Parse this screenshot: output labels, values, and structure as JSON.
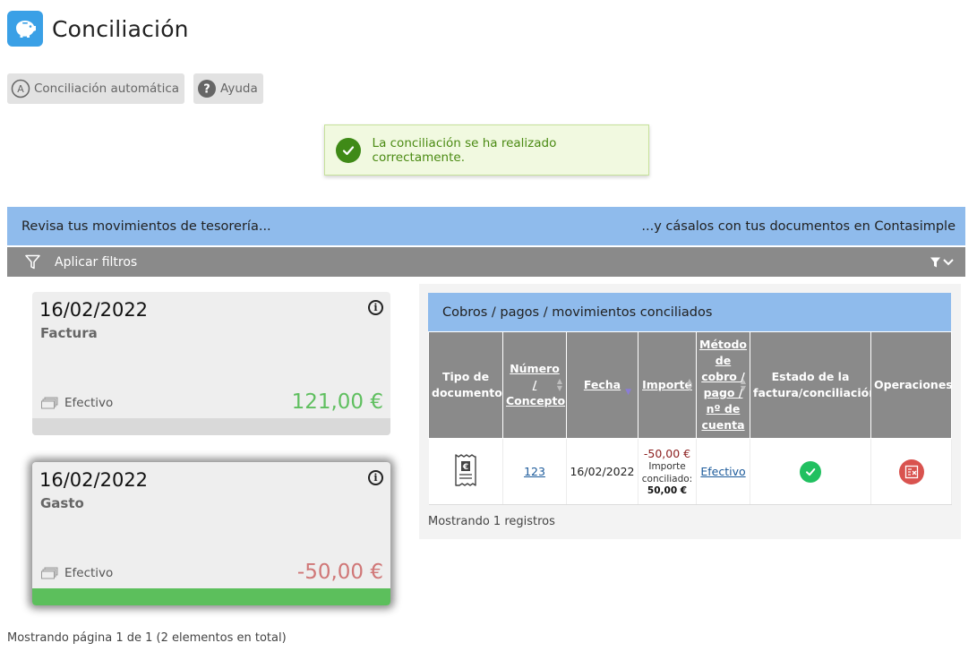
{
  "header": {
    "title": "Conciliación",
    "icon": "piggy-bank-icon"
  },
  "toolbar": {
    "auto_label": "Conciliación automática",
    "help_label": "Ayuda"
  },
  "alert": {
    "text": "La conciliación se ha realizado correctamente."
  },
  "banner": {
    "left": "Revisa tus movimientos de tesorería...",
    "right": "...y cásalos con tus documentos en Contasimple"
  },
  "filters": {
    "label": "Aplicar filtros"
  },
  "movements": [
    {
      "date": "16/02/2022",
      "kind": "Factura",
      "method": "Efectivo",
      "amount": "121,00 €",
      "status_color": "#d9d9d9"
    },
    {
      "date": "16/02/2022",
      "kind": "Gasto",
      "method": "Efectivo",
      "amount": "-50,00 €",
      "status_color": "#5cbf5c"
    }
  ],
  "paging": {
    "text": "Mostrando página 1 de 1 (2 elementos en total)"
  },
  "reconciled": {
    "title": "Cobros / pagos / movimientos conciliados",
    "columns": {
      "doc_type": "Tipo de documento",
      "number": "Número / Concepto",
      "date": "Fecha",
      "amount": "Importe",
      "method": "Método de cobro / pago / nº de cuenta",
      "status": "Estado de la factura/conciliación",
      "operations": "Operaciones"
    },
    "rows": [
      {
        "number": "123",
        "date": "16/02/2022",
        "amount": "-50,00 €",
        "reconciled_label": "Importe conciliado:",
        "reconciled_amount": "50,00 €",
        "method": "Efectivo"
      }
    ],
    "records": "Mostrando 1 registros"
  }
}
